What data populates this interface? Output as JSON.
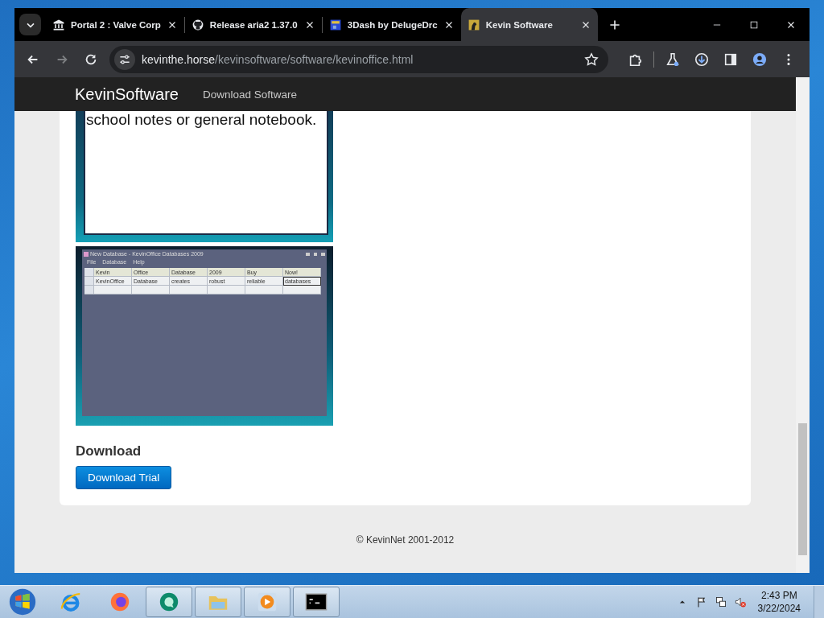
{
  "browser": {
    "tabs": [
      {
        "title": "Portal 2 : Valve Corp",
        "selected": false
      },
      {
        "title": "Release aria2 1.37.0",
        "selected": false
      },
      {
        "title": "3Dash by DelugeDrc",
        "selected": false
      },
      {
        "title": "Kevin Software",
        "selected": true
      }
    ],
    "url": {
      "host": "kevinthe.horse",
      "path": "/kevinsoftware/software/kevinoffice.html"
    },
    "forward_disabled": true
  },
  "site": {
    "brand": "KevinSoftware",
    "nav": [
      "Download Software"
    ]
  },
  "content": {
    "image_text": "school notes or general notebook.",
    "app_screenshot": {
      "title": "New Database - KevinOffice Databases 2009",
      "menu": [
        "File",
        "Database",
        "Help"
      ],
      "columns": [
        "Kevin",
        "Office",
        "Database",
        "2009",
        "Buy",
        "Now!"
      ],
      "rows": [
        [
          "KevinOffice",
          "Database",
          "creates",
          "robust",
          "reliable",
          "databases"
        ]
      ]
    },
    "heading": "Download",
    "button": "Download Trial"
  },
  "footer": "© KevinNet 2001-2012",
  "taskbar": {
    "apps": [
      {
        "active": false
      },
      {
        "active": false
      },
      {
        "active": true
      },
      {
        "active": true
      },
      {
        "active": true
      },
      {
        "active": true
      }
    ],
    "time": "2:43 PM",
    "date": "3/22/2024"
  }
}
